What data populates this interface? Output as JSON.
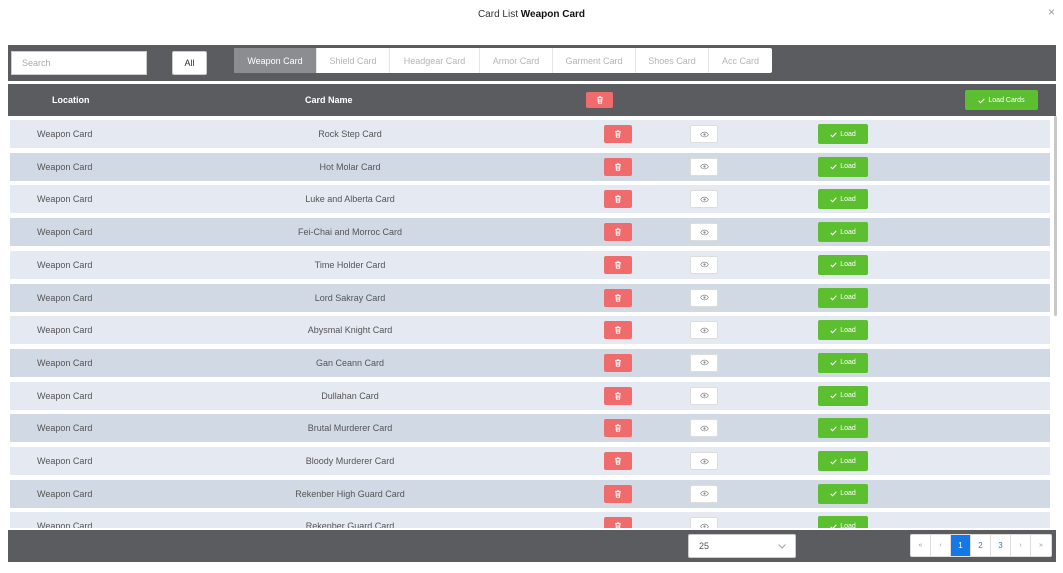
{
  "modal": {
    "title_prefix": "Card List",
    "title_bold": "Weapon Card",
    "close": "×"
  },
  "toolbar": {
    "search_placeholder": "Search",
    "all_label": "All",
    "tabs": [
      {
        "label": "Weapon Card",
        "active": true
      },
      {
        "label": "Shield Card",
        "active": false
      },
      {
        "label": "Headgear Card",
        "active": false
      },
      {
        "label": "Armor Card",
        "active": false
      },
      {
        "label": "Garment Card",
        "active": false
      },
      {
        "label": "Shoes Card",
        "active": false
      },
      {
        "label": "Acc Card",
        "active": false
      }
    ]
  },
  "table": {
    "headers": {
      "location": "Location",
      "card_name": "Card Name"
    },
    "load_cards_label": "Load Cards",
    "load_label": "Load",
    "rows": [
      {
        "location": "Weapon Card",
        "name": "Rock Step Card"
      },
      {
        "location": "Weapon Card",
        "name": "Hot Molar Card"
      },
      {
        "location": "Weapon Card",
        "name": "Luke and Alberta Card"
      },
      {
        "location": "Weapon Card",
        "name": "Fei-Chai and Morroc Card"
      },
      {
        "location": "Weapon Card",
        "name": "Time Holder Card"
      },
      {
        "location": "Weapon Card",
        "name": "Lord Sakray Card"
      },
      {
        "location": "Weapon Card",
        "name": "Abysmal Knight Card"
      },
      {
        "location": "Weapon Card",
        "name": "Gan Ceann Card"
      },
      {
        "location": "Weapon Card",
        "name": "Dullahan Card"
      },
      {
        "location": "Weapon Card",
        "name": "Brutal Murderer Card"
      },
      {
        "location": "Weapon Card",
        "name": "Bloody Murderer Card"
      },
      {
        "location": "Weapon Card",
        "name": "Rekenber High Guard Card"
      },
      {
        "location": "Weapon Card",
        "name": "Rekenber Guard Card"
      }
    ]
  },
  "footer": {
    "page_size": "25",
    "pager": [
      {
        "label": "«",
        "kind": "first"
      },
      {
        "label": "‹",
        "kind": "prev"
      },
      {
        "label": "1",
        "kind": "page",
        "active": true
      },
      {
        "label": "2",
        "kind": "page"
      },
      {
        "label": "3",
        "kind": "page"
      },
      {
        "label": "›",
        "kind": "next"
      },
      {
        "label": "»",
        "kind": "last"
      }
    ]
  },
  "colors": {
    "header_bg": "#5b5c60",
    "danger": "#f06b6b",
    "success": "#5cbf2f",
    "row_odd": "#e4e9f2",
    "row_even": "#d1d9e5",
    "pager_active": "#1479e6"
  },
  "icons": {
    "delete": "trash-icon",
    "view": "eye-icon",
    "load": "check-icon",
    "select": "chevron-down-icon"
  }
}
